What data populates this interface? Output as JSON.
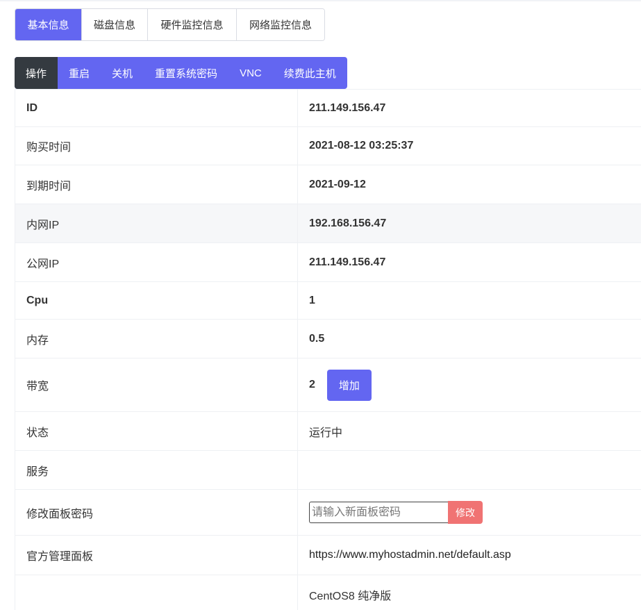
{
  "info_tabs": [
    {
      "label": "基本信息",
      "active": true
    },
    {
      "label": "磁盘信息",
      "active": false
    },
    {
      "label": "硬件监控信息",
      "active": false
    },
    {
      "label": "网络监控信息",
      "active": false
    }
  ],
  "operations": [
    "操作",
    "重启",
    "关机",
    "重置系统密码",
    "VNC",
    "续费此主机"
  ],
  "rows": {
    "id": {
      "label": "ID",
      "value": "211.149.156.47"
    },
    "purchase": {
      "label": "购买时间",
      "value": "2021-08-12 03:25:37"
    },
    "expire": {
      "label": "到期时间",
      "value": "2021-09-12"
    },
    "lan_ip": {
      "label": "内网IP",
      "value": "192.168.156.47"
    },
    "wan_ip": {
      "label": "公网IP",
      "value": "211.149.156.47"
    },
    "cpu": {
      "label": "Cpu",
      "value": "1"
    },
    "memory": {
      "label": "内存",
      "value": "0.5"
    },
    "bandwidth": {
      "label": "带宽",
      "value": "2",
      "button": "增加"
    },
    "status": {
      "label": "状态",
      "value": "运行中"
    },
    "service": {
      "label": "服务",
      "value": ""
    },
    "panel_pw": {
      "label": "修改面板密码",
      "placeholder": "请输入新面板密码",
      "button": "修改"
    },
    "panel": {
      "label": "官方管理面板",
      "value": "https://www.myhostadmin.net/default.asp"
    },
    "os": {
      "label": "",
      "value": "CentOS8 纯净版"
    }
  },
  "colors": {
    "accent": "#6366f1",
    "dark": "#343a40",
    "danger": "#f07373"
  }
}
